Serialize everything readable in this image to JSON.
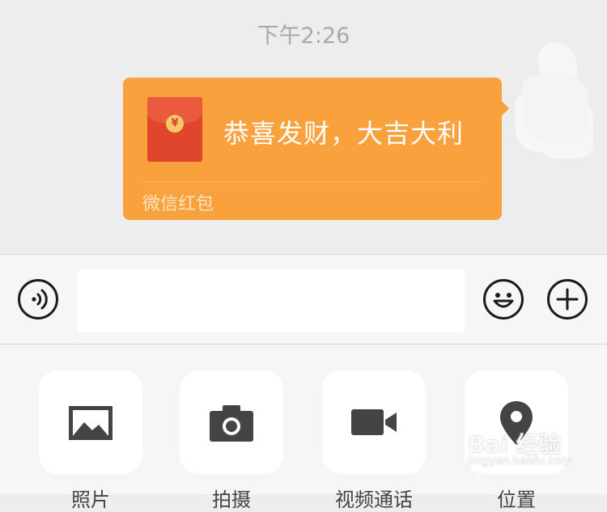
{
  "chat": {
    "timestamp": "下午2:26",
    "red_packet": {
      "title": "恭喜发财，大吉大利",
      "label": "微信红包",
      "currency_symbol": "¥",
      "bubble_color": "#f9a13c",
      "envelope_color": "#e0462c"
    }
  },
  "input_bar": {
    "voice_icon": "voice-icon",
    "text_value": "",
    "emoji_icon": "emoji-icon",
    "more_icon": "plus-icon"
  },
  "panel": {
    "items": [
      {
        "label": "照片",
        "icon": "photo-icon"
      },
      {
        "label": "拍摄",
        "icon": "camera-icon"
      },
      {
        "label": "视频通话",
        "icon": "video-call-icon"
      },
      {
        "label": "位置",
        "icon": "location-icon"
      }
    ]
  },
  "watermark": {
    "brand": "Bai 经验",
    "url": "jingyan.baidu.com"
  }
}
